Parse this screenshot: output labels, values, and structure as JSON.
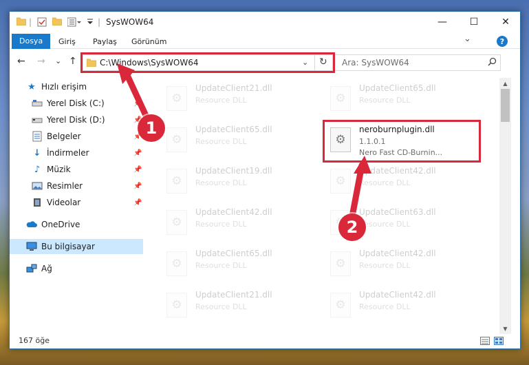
{
  "window": {
    "title": "SysWOW64",
    "controls": {
      "minimize": "—",
      "maximize": "☐",
      "close": "✕"
    }
  },
  "ribbon": {
    "tabs": [
      "Dosya",
      "Giriş",
      "Paylaş",
      "Görünüm"
    ],
    "help_icon": "?",
    "expand_icon": "⌄"
  },
  "navbar": {
    "back": "←",
    "forward": "→",
    "recent": "⌄",
    "up": "↑",
    "address": "C:\\Windows\\SysWOW64",
    "search_placeholder": "Ara: SysWOW64"
  },
  "sidebar": {
    "items": [
      {
        "label": "Hızlı erişim",
        "icon": "star-icon",
        "pinned": false
      },
      {
        "label": "Yerel Disk (C:)",
        "icon": "drive-icon",
        "pinned": true
      },
      {
        "label": "Yerel Disk (D:)",
        "icon": "drive-icon",
        "pinned": true
      },
      {
        "label": "Belgeler",
        "icon": "documents-icon",
        "pinned": true
      },
      {
        "label": "İndirmeler",
        "icon": "download-icon",
        "pinned": true
      },
      {
        "label": "Müzik",
        "icon": "music-icon",
        "pinned": true
      },
      {
        "label": "Resimler",
        "icon": "pictures-icon",
        "pinned": true
      },
      {
        "label": "Videolar",
        "icon": "videos-icon",
        "pinned": true
      },
      {
        "label": "OneDrive",
        "icon": "cloud-icon",
        "pinned": false
      },
      {
        "label": "Bu bilgisayar",
        "icon": "computer-icon",
        "pinned": false,
        "selected": true
      },
      {
        "label": "Ağ",
        "icon": "network-icon",
        "pinned": false
      }
    ]
  },
  "files": {
    "left": [
      {
        "name": "UpdateClient21.dll",
        "type": "Resource DLL"
      },
      {
        "name": "UpdateClient65.dll",
        "type": "Resource DLL"
      },
      {
        "name": "UpdateClient19.dll",
        "type": "Resource DLL"
      },
      {
        "name": "UpdateClient42.dll",
        "type": "Resource DLL"
      },
      {
        "name": "UpdateClient65.dll",
        "type": "Resource DLL"
      },
      {
        "name": "UpdateClient21.dll",
        "type": "Resource DLL"
      }
    ],
    "right": [
      {
        "name": "UpdateClient65.dll",
        "type": "Resource DLL"
      },
      {
        "name": "neroburnplugin.dll",
        "version": "1.1.0.1",
        "description": "Nero Fast CD-Burnin...",
        "highlighted": true
      },
      {
        "name": "UpdateClient42.dll",
        "type": "Resource DLL"
      },
      {
        "name": "UpdateClient63.dll",
        "type": "Resource DLL"
      },
      {
        "name": "UpdateClient42.dll",
        "type": "Resource DLL"
      },
      {
        "name": "UpdateClient42.dll",
        "type": "Resource DLL"
      }
    ]
  },
  "status": {
    "item_count": "167 öğe"
  },
  "annotations": {
    "step1": "1",
    "step2": "2",
    "color": "#d8283a"
  }
}
